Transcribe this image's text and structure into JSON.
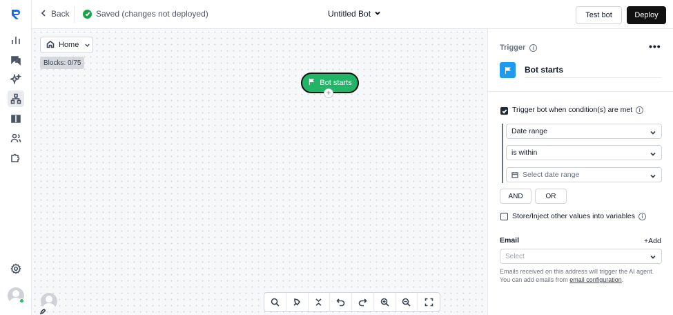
{
  "topbar": {
    "back_label": "Back",
    "status_text": "Saved (changes not deployed)",
    "bot_name": "Untitled Bot",
    "test_label": "Test bot",
    "deploy_label": "Deploy"
  },
  "canvas": {
    "home_label": "Home",
    "blocks_text": "Blocks: 0/75",
    "node_label": "Bot starts",
    "node_plus": "+",
    "node_color": "#22b567"
  },
  "panel": {
    "section_label": "Trigger",
    "menu_glyph": "•••",
    "title": "Bot starts",
    "condition_checkbox": {
      "label": "Trigger bot when condition(s) are met",
      "checked": true
    },
    "condition_field": "Date range",
    "condition_operator": "is within",
    "date_placeholder": "Select date range",
    "and_label": "AND",
    "or_label": "OR",
    "store_checkbox": {
      "label": "Store/Inject other values into variables",
      "checked": false
    },
    "email_label": "Email",
    "add_label": "+Add",
    "email_placeholder": "Select",
    "help_text": "Emails received on this address will trigger the AI agent. You can add emails from",
    "help_link": "email configuration",
    "help_end": ".",
    "accent_color": "#1e9bf0"
  },
  "rail": {
    "icons": [
      "analytics-icon",
      "chat-icon",
      "ai-sparkle-icon",
      "flow-builder-icon",
      "tickets-icon",
      "contacts-icon",
      "integrations-icon",
      "settings-icon"
    ]
  }
}
